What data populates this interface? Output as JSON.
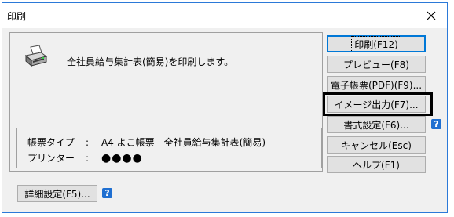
{
  "window": {
    "title": "印刷"
  },
  "message": "全社員給与集計表(簡易)を印刷します。",
  "info": {
    "form_type_label": "帳票タイプ",
    "form_type_value": "A4 よこ帳票　全社員給与集計表(簡易)",
    "printer_label": "プリンター",
    "printer_value": "●●●●",
    "colon": ":"
  },
  "buttons": {
    "print": "印刷(F12)",
    "preview": "プレビュー(F8)",
    "pdf": "電子帳票(PDF)(F9)...",
    "image": "イメージ出力(F7)...",
    "format": "書式設定(F6)...",
    "cancel": "キャンセル(Esc)",
    "help": "ヘルプ(F1)",
    "detail": "詳細設定(F5)..."
  },
  "help_glyph": "?",
  "icons": {
    "close": "close-icon",
    "printer": "printer-icon",
    "help": "help-icon"
  },
  "colors": {
    "accent": "#0078d7",
    "help_badge": "#1f6fd1",
    "highlight_box": "#000000"
  }
}
